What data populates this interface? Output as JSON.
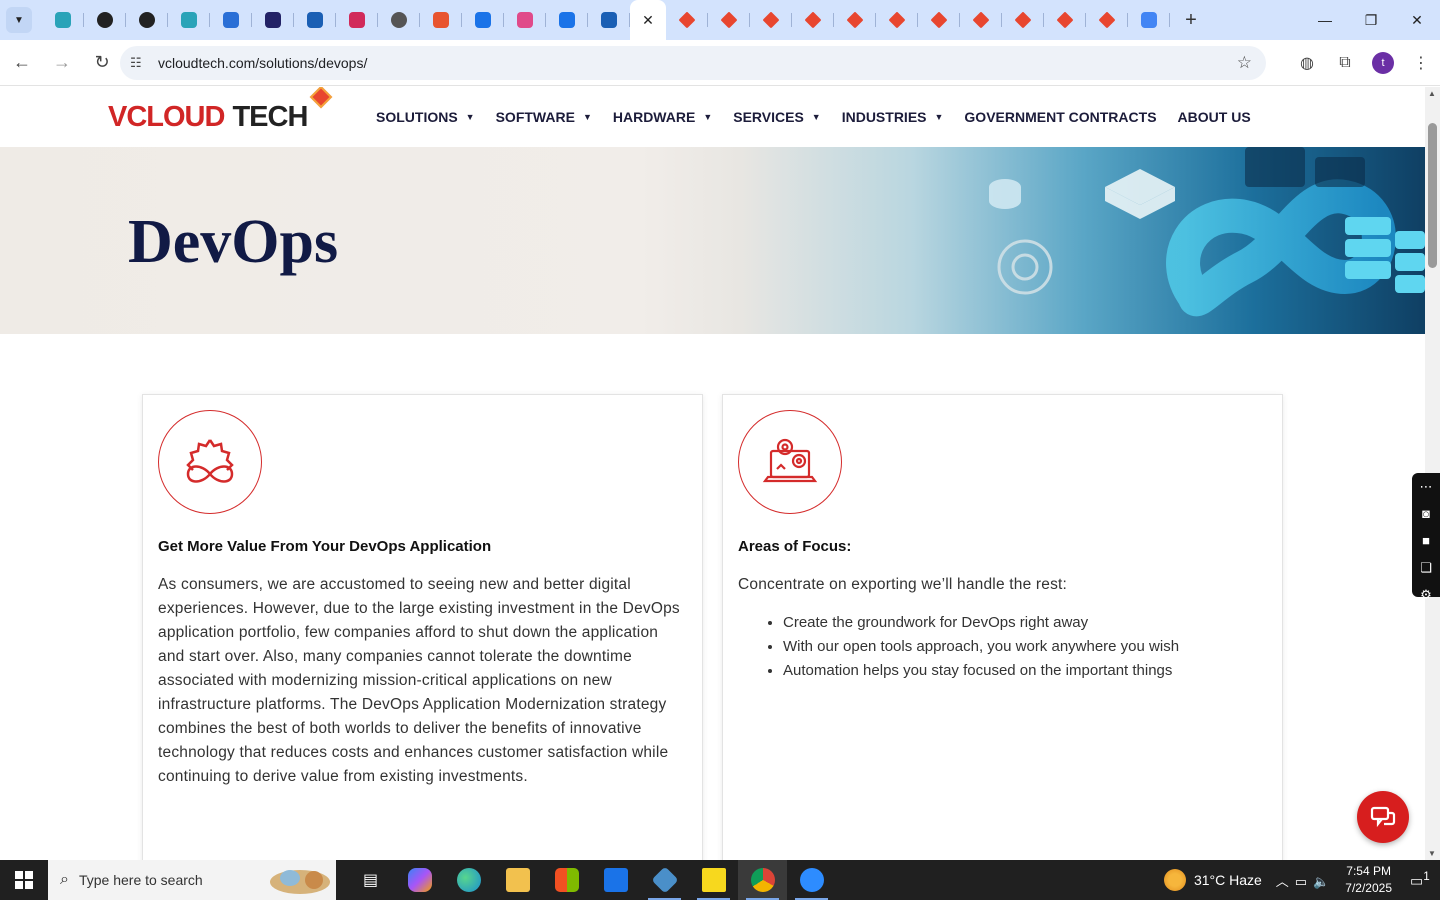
{
  "browser": {
    "url": "vcloudtech.com/solutions/devops/",
    "tabs": [
      {
        "icon": "teal-hex-icon",
        "color": "#2aa3b8"
      },
      {
        "icon": "gear-logo-icon",
        "color": "#222222"
      },
      {
        "icon": "target-icon",
        "color": "#222222"
      },
      {
        "icon": "teal-hex-icon",
        "color": "#2aa3b8"
      },
      {
        "icon": "scales-icon",
        "color": "#2a6fd6"
      },
      {
        "icon": "x-cross-icon",
        "color": "#222266"
      },
      {
        "icon": "check-swoosh-icon",
        "color": "#1a5fb4"
      },
      {
        "icon": "stitch-icon",
        "color": "#d12a5a"
      },
      {
        "icon": "globe-icon",
        "color": "#555555"
      },
      {
        "icon": "pen-curve-icon",
        "color": "#e8542f"
      },
      {
        "icon": "doc-icon",
        "color": "#1a73e8"
      },
      {
        "icon": "feather-icon",
        "color": "#e04a8a"
      },
      {
        "icon": "pulse-icon",
        "color": "#1a73e8"
      },
      {
        "icon": "gauge-icon",
        "color": "#1a5fb4"
      },
      {
        "icon": "close-icon",
        "active": true
      },
      {
        "icon": "vcloud-diamond-icon",
        "color": "#e8462f"
      },
      {
        "icon": "vcloud-diamond-icon",
        "color": "#e8462f"
      },
      {
        "icon": "vcloud-diamond-icon",
        "color": "#e8462f"
      },
      {
        "icon": "vcloud-diamond-icon",
        "color": "#e8462f"
      },
      {
        "icon": "vcloud-diamond-icon",
        "color": "#e8462f"
      },
      {
        "icon": "vcloud-diamond-icon",
        "color": "#e8462f"
      },
      {
        "icon": "vcloud-diamond-icon",
        "color": "#e8462f"
      },
      {
        "icon": "vcloud-diamond-icon",
        "color": "#e8462f"
      },
      {
        "icon": "vcloud-diamond-icon",
        "color": "#e8462f"
      },
      {
        "icon": "vcloud-diamond-icon",
        "color": "#e8462f"
      },
      {
        "icon": "vcloud-diamond-icon",
        "color": "#e8462f"
      },
      {
        "icon": "google-g-icon",
        "color": "#4285f4"
      }
    ],
    "profile_initial": "t"
  },
  "site": {
    "logo": {
      "v": "V",
      "cloud": "CLOUD",
      "tech": "TECH"
    },
    "nav": [
      {
        "label": "SOLUTIONS",
        "dropdown": true
      },
      {
        "label": "SOFTWARE",
        "dropdown": true
      },
      {
        "label": "HARDWARE",
        "dropdown": true
      },
      {
        "label": "SERVICES",
        "dropdown": true
      },
      {
        "label": "INDUSTRIES",
        "dropdown": true
      },
      {
        "label": "GOVERNMENT CONTRACTS",
        "dropdown": false
      },
      {
        "label": "ABOUT US",
        "dropdown": false
      }
    ],
    "hero_title": "DevOps",
    "cards": {
      "left": {
        "title": "Get More Value From Your DevOps Application",
        "body": "As consumers, we are accustomed to seeing new and better digital experiences. However, due to the large existing investment in the DevOps application portfolio, few companies afford to shut down the application and start over. Also, many companies cannot tolerate the downtime associated with modernizing mission-critical applications on new infrastructure platforms. The DevOps Application Modernization strategy combines the best of both worlds to deliver the benefits of innovative technology that reduces costs and enhances customer satisfaction while continuing to derive value from existing investments."
      },
      "right": {
        "title": "Areas of Focus:",
        "intro": "Concentrate on exporting we’ll handle the rest:",
        "bullets": [
          "Create the groundwork for DevOps right away",
          "With our open tools approach, you work anywhere you wish",
          "Automation helps you stay focused on the important things"
        ]
      }
    },
    "accent_color": "#d12626",
    "title_color": "#111a45"
  },
  "taskbar": {
    "search_placeholder": "Type here to search",
    "weather": "31°C  Haze",
    "time": "7:54 PM",
    "date": "7/2/2025",
    "notifications": "1"
  }
}
